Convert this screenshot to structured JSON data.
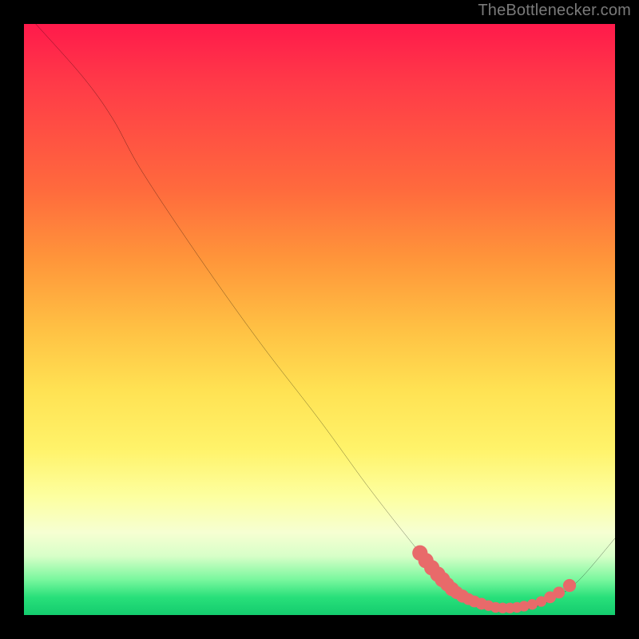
{
  "attribution": "TheBottlenecker.com",
  "chart_data": {
    "type": "line",
    "title": "",
    "xlabel": "",
    "ylabel": "",
    "xlim": [
      0,
      100
    ],
    "ylim": [
      0,
      100
    ],
    "curve": [
      {
        "x": 2,
        "y": 100
      },
      {
        "x": 10,
        "y": 91
      },
      {
        "x": 15,
        "y": 84
      },
      {
        "x": 20,
        "y": 75
      },
      {
        "x": 30,
        "y": 60
      },
      {
        "x": 40,
        "y": 46
      },
      {
        "x": 50,
        "y": 33
      },
      {
        "x": 58,
        "y": 22
      },
      {
        "x": 65,
        "y": 13
      },
      {
        "x": 70,
        "y": 7
      },
      {
        "x": 74,
        "y": 3.5
      },
      {
        "x": 78,
        "y": 1.5
      },
      {
        "x": 82,
        "y": 0.8
      },
      {
        "x": 86,
        "y": 1.2
      },
      {
        "x": 90,
        "y": 3
      },
      {
        "x": 94,
        "y": 6
      },
      {
        "x": 100,
        "y": 13
      }
    ],
    "markers": [
      {
        "x": 67,
        "y": 10.5,
        "r": 1.3
      },
      {
        "x": 68,
        "y": 9.2,
        "r": 1.3
      },
      {
        "x": 69,
        "y": 8.0,
        "r": 1.3
      },
      {
        "x": 70,
        "y": 6.9,
        "r": 1.3
      },
      {
        "x": 70.8,
        "y": 6.0,
        "r": 1.3
      },
      {
        "x": 71.6,
        "y": 5.2,
        "r": 1.2
      },
      {
        "x": 72.4,
        "y": 4.4,
        "r": 1.2
      },
      {
        "x": 73.2,
        "y": 3.8,
        "r": 1.1
      },
      {
        "x": 74.2,
        "y": 3.2,
        "r": 1.1
      },
      {
        "x": 75.2,
        "y": 2.7,
        "r": 1.0
      },
      {
        "x": 76.2,
        "y": 2.3,
        "r": 1.0
      },
      {
        "x": 77.4,
        "y": 1.9,
        "r": 1.0
      },
      {
        "x": 78.6,
        "y": 1.6,
        "r": 0.9
      },
      {
        "x": 79.8,
        "y": 1.3,
        "r": 0.9
      },
      {
        "x": 81.0,
        "y": 1.2,
        "r": 0.9
      },
      {
        "x": 82.2,
        "y": 1.2,
        "r": 0.9
      },
      {
        "x": 83.4,
        "y": 1.3,
        "r": 0.9
      },
      {
        "x": 84.6,
        "y": 1.5,
        "r": 0.9
      },
      {
        "x": 86.0,
        "y": 1.8,
        "r": 0.9
      },
      {
        "x": 87.5,
        "y": 2.3,
        "r": 0.9
      },
      {
        "x": 89.0,
        "y": 3.0,
        "r": 1.0
      },
      {
        "x": 90.5,
        "y": 3.8,
        "r": 1.0
      },
      {
        "x": 92.3,
        "y": 5.0,
        "r": 1.1
      }
    ],
    "colors": {
      "curve": "#000000",
      "marker": "#e86a6a"
    }
  }
}
